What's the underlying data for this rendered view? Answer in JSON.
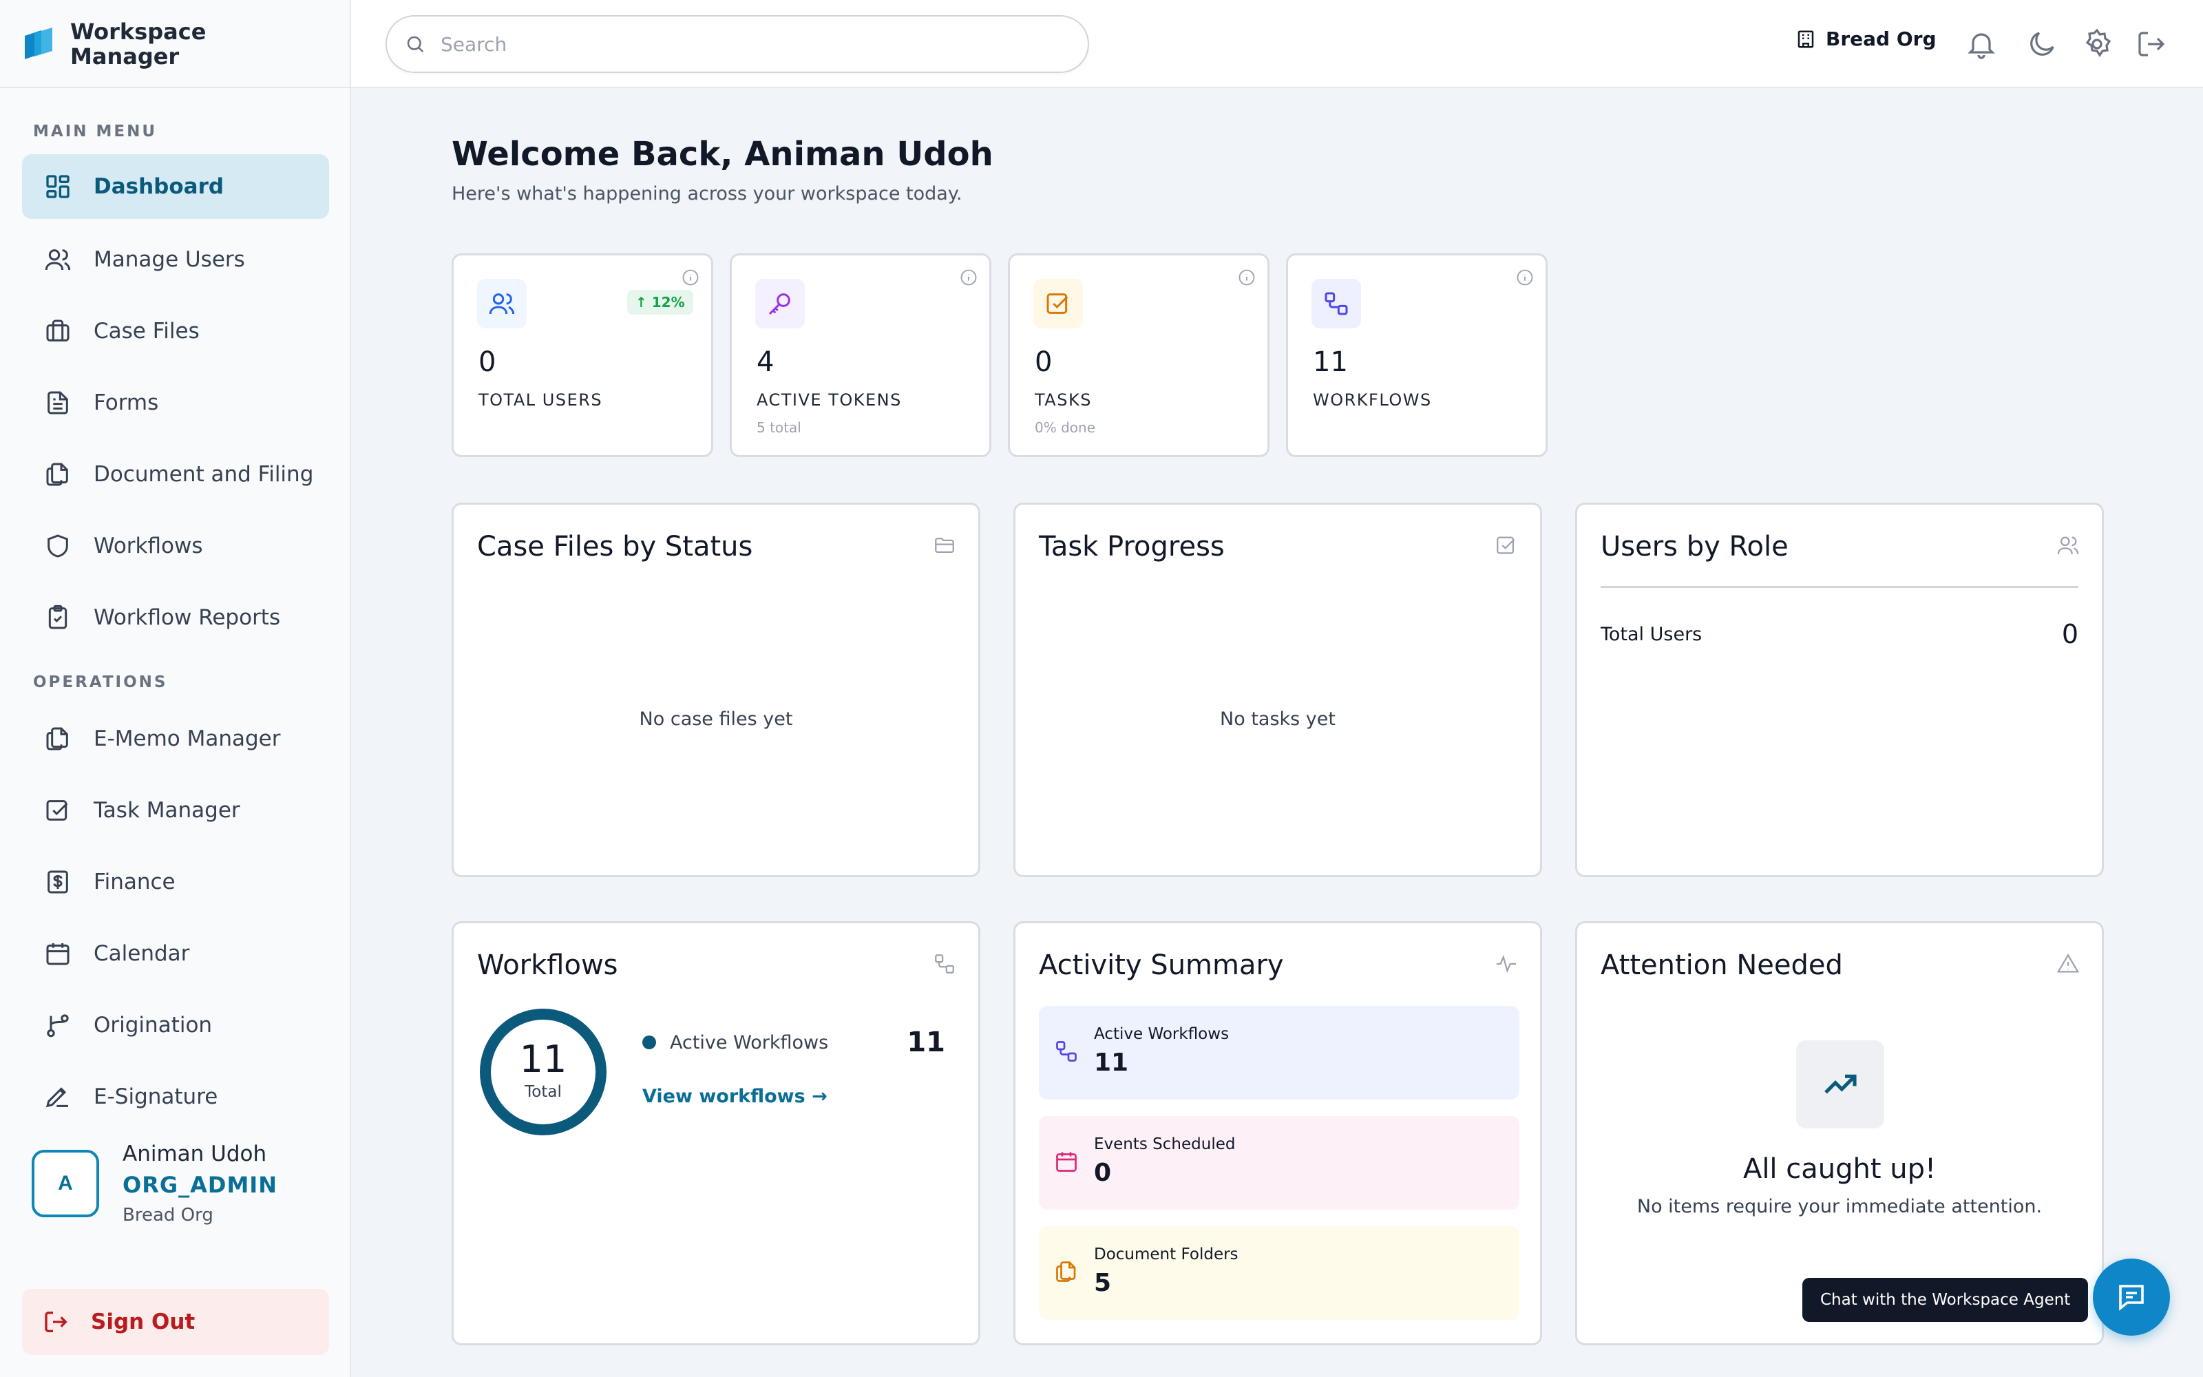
{
  "brand": {
    "line1": "Workspace",
    "line2": "Manager"
  },
  "sidebar": {
    "main_menu_label": "MAIN MENU",
    "operations_label": "OPERATIONS",
    "main_items": [
      {
        "label": "Dashboard",
        "icon": "dashboard-icon",
        "active": true
      },
      {
        "label": "Manage Users",
        "icon": "users-icon"
      },
      {
        "label": "Case Files",
        "icon": "briefcase-icon"
      },
      {
        "label": "Forms",
        "icon": "form-icon"
      },
      {
        "label": "Document and Filing",
        "icon": "documents-icon"
      },
      {
        "label": "Workflows",
        "icon": "shield-icon"
      },
      {
        "label": "Workflow Reports",
        "icon": "clipboard-check-icon"
      }
    ],
    "operations_items": [
      {
        "label": "E-Memo Manager",
        "icon": "memo-icon"
      },
      {
        "label": "Task Manager",
        "icon": "checkbox-icon"
      },
      {
        "label": "Finance",
        "icon": "dollar-icon"
      },
      {
        "label": "Calendar",
        "icon": "calendar-icon"
      },
      {
        "label": "Origination",
        "icon": "git-branch-icon"
      },
      {
        "label": "E-Signature",
        "icon": "pen-icon"
      }
    ],
    "user": {
      "initial": "A",
      "name": "Animan Udoh",
      "role": "ORG_ADMIN",
      "org": "Bread Org"
    },
    "sign_out_label": "Sign Out"
  },
  "topbar": {
    "search_placeholder": "Search",
    "org_name": "Bread Org",
    "icons": [
      "bell-icon",
      "moon-icon",
      "gear-icon",
      "logout-icon"
    ]
  },
  "main": {
    "welcome": "Welcome Back, Animan Udoh",
    "subtitle": "Here's what's happening across your workspace today.",
    "stats": [
      {
        "value": "0",
        "label": "TOTAL USERS",
        "sub": "",
        "trend": "12%",
        "icon": "users-icon",
        "color": "#2563eb",
        "bg": "#eff6ff"
      },
      {
        "value": "4",
        "label": "ACTIVE TOKENS",
        "sub": "5 total",
        "icon": "key-icon",
        "color": "#9333ea",
        "bg": "#f5f0ff"
      },
      {
        "value": "0",
        "label": "TASKS",
        "sub": "0% done",
        "icon": "checkbox-icon",
        "color": "#d97706",
        "bg": "#fff8e6"
      },
      {
        "value": "11",
        "label": "WORKFLOWS",
        "sub": "",
        "icon": "workflow-icon",
        "color": "#4f46e5",
        "bg": "#eef0ff"
      }
    ],
    "case_files": {
      "title": "Case Files by Status",
      "empty": "No case files yet"
    },
    "task_progress": {
      "title": "Task Progress",
      "empty": "No tasks yet"
    },
    "users_by_role": {
      "title": "Users by Role",
      "total_label": "Total Users",
      "total_value": "0"
    },
    "workflows": {
      "title": "Workflows",
      "total": "11",
      "total_label": "Total",
      "legend_label": "Active Workflows",
      "legend_value": "11",
      "link": "View workflows →"
    },
    "activity": {
      "title": "Activity Summary",
      "items": [
        {
          "label": "Active Workflows",
          "value": "11",
          "bg": "#eef2fe",
          "color": "#4f46e5",
          "icon": "workflow-icon"
        },
        {
          "label": "Events Scheduled",
          "value": "0",
          "bg": "#fdf0f6",
          "color": "#db2777",
          "icon": "calendar-icon"
        },
        {
          "label": "Document Folders",
          "value": "5",
          "bg": "#fefbea",
          "color": "#d97706",
          "icon": "documents-icon"
        }
      ]
    },
    "attention": {
      "title": "Attention Needed",
      "headline": "All caught up!",
      "message": "No items require your immediate attention."
    }
  },
  "chat": {
    "tooltip": "Chat with the Workspace Agent"
  },
  "colors": {
    "accent": "#0b5a7c",
    "primary_button": "#0e86c8",
    "danger": "#b91c1c"
  }
}
